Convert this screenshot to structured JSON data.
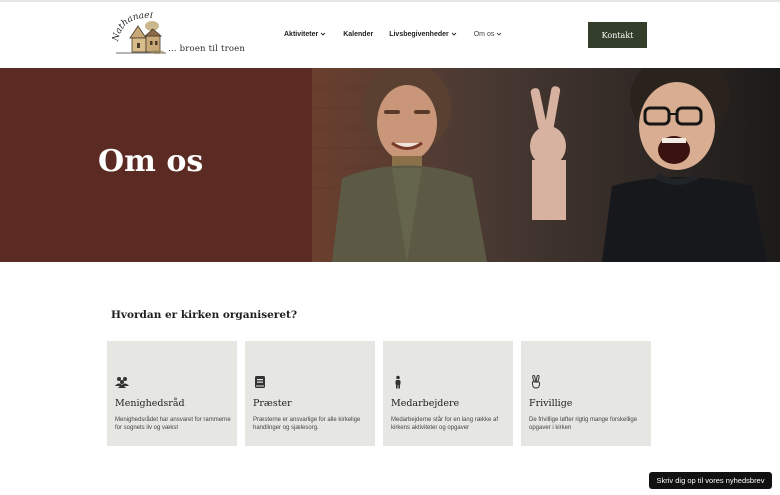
{
  "header": {
    "logo_tagline": "... broen til troen",
    "logo_script": "Nathanaels",
    "nav": [
      {
        "label": "Aktiviteter",
        "dropdown": true
      },
      {
        "label": "Kalender",
        "dropdown": false
      },
      {
        "label": "Livsbegivenheder",
        "dropdown": true
      },
      {
        "label": "Om os",
        "dropdown": true
      }
    ],
    "contact_label": "Kontakt"
  },
  "hero": {
    "title": "Om os",
    "bg_color": "#5a2a23"
  },
  "section": {
    "title": "Hvordan er kirken organiseret?",
    "cards": [
      {
        "icon": "group-icon",
        "title": "Menighedsråd",
        "text": "Menighedsrådet har ansvaret for rammerne for sognets liv og vækst"
      },
      {
        "icon": "book-icon",
        "title": "Præster",
        "text": "Præsterne er ansvarlige for alle kirkelige handlinger og sjælesorg."
      },
      {
        "icon": "person-icon",
        "title": "Medarbejdere",
        "text": "Medarbejderne står for en lang række af kirkens aktiviteter og opgaver"
      },
      {
        "icon": "peace-hand-icon",
        "title": "Frivillige",
        "text": "De frivillige løfter rigtig mange forskellige opgaver i kirken"
      }
    ]
  },
  "newsletter_label": "Skriv dig op til vores nyhedsbrev",
  "colors": {
    "accent": "#333f2a",
    "hero": "#5a2a23",
    "card": "#e6e6e3"
  }
}
